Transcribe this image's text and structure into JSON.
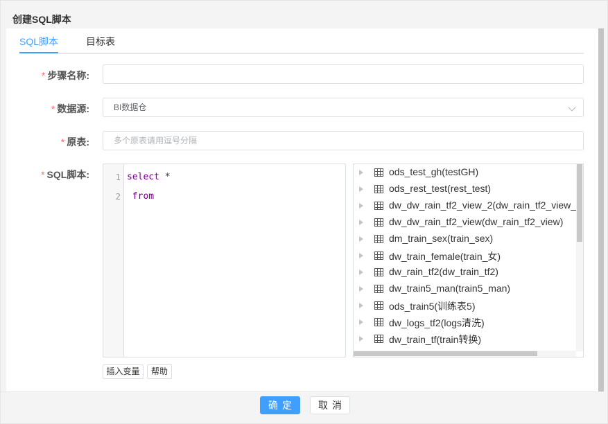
{
  "dialog": {
    "title": "创建SQL脚本"
  },
  "tabs": [
    {
      "label": "SQL脚本",
      "active": true
    },
    {
      "label": "目标表",
      "active": false
    }
  ],
  "form": {
    "required_mark": "*",
    "step_name": {
      "label": "步骤名称:",
      "value": ""
    },
    "datasource": {
      "label": "数据源:",
      "value": "BI数据仓"
    },
    "source_table": {
      "label": "原表:",
      "placeholder": "多个原表请用逗号分隔"
    },
    "sql_script": {
      "label": "SQL脚本:"
    }
  },
  "editor": {
    "lines": [
      {
        "no": "1",
        "keyword": "select",
        "rest": " *"
      },
      {
        "no": "2",
        "keyword": " from",
        "rest": ""
      }
    ]
  },
  "tree": {
    "items": [
      "ods_test_gh(testGH)",
      "ods_rest_test(rest_test)",
      "dw_dw_rain_tf2_view_2(dw_rain_tf2_view_",
      "dw_dw_rain_tf2_view(dw_rain_tf2_view)",
      "dm_train_sex(train_sex)",
      "dw_train_female(train_女)",
      "dw_rain_tf2(dw_train_tf2)",
      "dw_train5_man(train5_man)",
      "ods_train5(训练表5)",
      "dw_logs_tf2(logs清洗)",
      "dw_train_tf(train转换)"
    ]
  },
  "editor_buttons": {
    "insert_variable": "插入变量",
    "help": "帮助"
  },
  "footer": {
    "confirm": "确定",
    "cancel": "取消"
  },
  "colors": {
    "accent": "#409eff",
    "required": "#f56c6c",
    "keyword": "#770088"
  }
}
